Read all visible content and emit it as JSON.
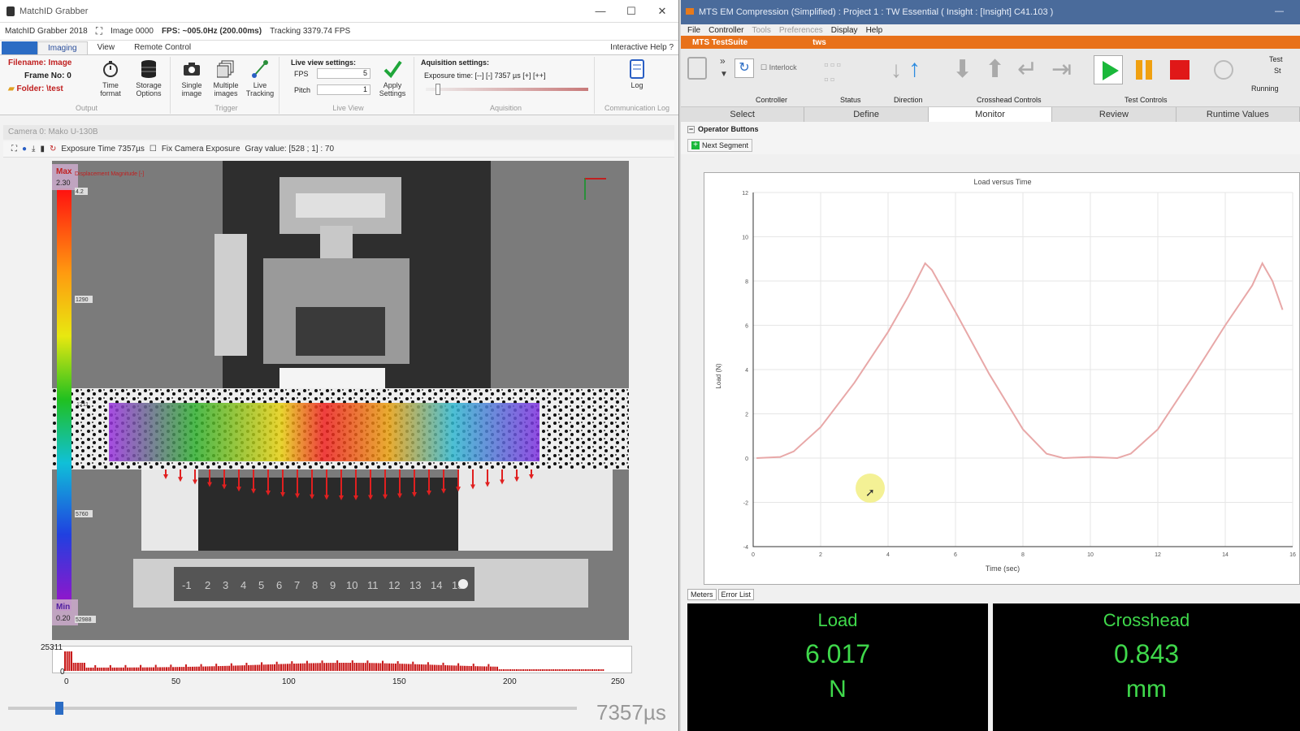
{
  "left_window": {
    "title": "MatchID Grabber",
    "controls": [
      "—",
      "☐",
      "✕"
    ],
    "infobar": {
      "app": "MatchID Grabber 2018",
      "image": "Image 0000",
      "fps": "FPS: ~005.0Hz (200.00ms)",
      "tracking": "Tracking 3379.74 FPS"
    },
    "tabs": [
      "Imaging",
      "View",
      "Remote Control"
    ],
    "help": "Interactive Help",
    "ribbon": {
      "filename": "Filename: Image",
      "frame": "Frame No: 0",
      "folder": "Folder: \\test",
      "time_format": "Time format",
      "storage_options": "Storage Options",
      "output_label": "Output",
      "single_image": "Single image",
      "multiple_images": "Multiple images",
      "live_tracking": "Live Tracking",
      "trigger_label": "Trigger",
      "live_view_title": "Live view settings:",
      "fps_label": "FPS",
      "fps_value": "5",
      "pitch_label": "Pitch",
      "pitch_value": "1",
      "live_view_label": "Live View",
      "apply_settings": "Apply Settings",
      "acq_title": "Aquisition settings:",
      "exposure_label": "Exposure time: [--] [-] 7357 µs [+] [++]",
      "acq_label": "Aquisition",
      "log": "Log",
      "comm_log_label": "Communication Log"
    },
    "camera_header": "Camera 0: Mako U-130B",
    "camera_toolbar": {
      "exposure": "Exposure Time 7357µs",
      "fix": "Fix Camera Exposure",
      "gray": "Gray value: [528 ; 1] : 70"
    },
    "colorbar": {
      "max_label": "Max",
      "max_value": "2.30",
      "min_label": "Min",
      "min_value": "0.20",
      "title": "Displacement Magnitude [-]",
      "ticks": [
        "4.2",
        "1290",
        "5760",
        "1211",
        "52988"
      ]
    },
    "ruler": [
      "-1",
      "2",
      "3",
      "4",
      "5",
      "6",
      "7",
      "8",
      "9",
      "10",
      "11",
      "12",
      "13",
      "14",
      "15"
    ],
    "histogram": {
      "ymax": "25311",
      "ymin": "0",
      "xticks": [
        "0",
        "50",
        "100",
        "150",
        "200",
        "250"
      ]
    },
    "exposure_big": "7357µs"
  },
  "right_window": {
    "title": "MTS EM Compression (Simplified) : Project 1 : TW Essential ( Insight : [Insight] C41.103 )",
    "menu": [
      "File",
      "Controller",
      "Tools",
      "Preferences",
      "Display",
      "Help"
    ],
    "brand": "MTS TestSuite",
    "user": "tws",
    "toolbar": {
      "interlock": "Interlock",
      "controller": "Controller",
      "status": "Status",
      "direction": "Direction",
      "crosshead": "Crosshead Controls",
      "test_controls": "Test Controls",
      "test_label": "Test",
      "running": "Running",
      "st": "St"
    },
    "tabs": [
      "Select",
      "Define",
      "Monitor",
      "Review",
      "Runtime Values"
    ],
    "active_tab": "Monitor",
    "operator_buttons": "Operator Buttons",
    "next_segment": "Next Segment",
    "meters_tabs": [
      "Meters",
      "Error List"
    ],
    "meters": [
      {
        "label": "Load",
        "value": "6.017",
        "unit": "N"
      },
      {
        "label": "Crosshead",
        "value": "0.843",
        "unit": "mm"
      }
    ],
    "colors": {
      "curve": "#e8a8a8",
      "meter_text": "#3fd84b",
      "orange": "#e8711a"
    }
  },
  "chart_data": {
    "type": "line",
    "title": "Load versus Time",
    "xlabel": "Time (sec)",
    "ylabel": "Load (N)",
    "xlim": [
      0,
      16
    ],
    "ylim": [
      -4,
      12
    ],
    "xticks": [
      0,
      2,
      4,
      6,
      8,
      10,
      12,
      14,
      16
    ],
    "yticks": [
      -4,
      -2,
      0,
      2,
      4,
      6,
      8,
      10,
      12
    ],
    "grid": true,
    "series": [
      {
        "x": [
          0.1,
          0.8,
          1.2,
          2.0,
          3.0,
          4.0,
          4.6,
          5.1,
          5.3,
          6.0,
          7.0,
          8.0,
          8.7,
          9.2,
          10.0,
          10.8,
          11.2,
          12.0,
          13.0,
          14.0,
          14.8,
          15.1,
          15.4,
          15.7
        ],
        "y": [
          0.0,
          0.05,
          0.3,
          1.4,
          3.4,
          5.7,
          7.3,
          8.8,
          8.5,
          6.6,
          3.8,
          1.3,
          0.2,
          0.0,
          0.05,
          0.0,
          0.2,
          1.3,
          3.6,
          6.0,
          7.8,
          8.8,
          8.0,
          6.7
        ]
      }
    ]
  }
}
